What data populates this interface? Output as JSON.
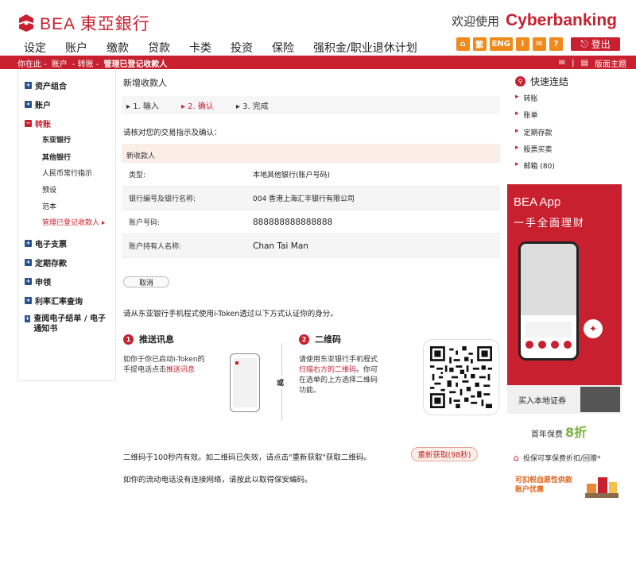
{
  "header": {
    "logo_text": "BEA 東亞銀行",
    "welcome_label": "欢迎使用",
    "welcome_brand": "Cyberbanking",
    "nav": [
      "设定",
      "账户",
      "缴款",
      "贷款",
      "卡类",
      "投资",
      "保险",
      "强积金/职业退休计划"
    ],
    "tools": [
      "⌂",
      "繁",
      "ENG",
      "i",
      "✉",
      "?"
    ],
    "logout_label": "登出"
  },
  "breadcrumb": {
    "items": [
      "你在此 -",
      "账户",
      "- 转账 -",
      "管理已登记收款人"
    ],
    "version_label": "版面主题"
  },
  "sidebar": {
    "sections": [
      {
        "label": "资产组合"
      },
      {
        "label": "账户"
      },
      {
        "label": "转账"
      },
      {
        "label": "电子支票"
      },
      {
        "label": "定期存款"
      },
      {
        "label": "申领"
      },
      {
        "label": "利率汇率查询"
      },
      {
        "label": "查阅电子结单 / 电子通知书"
      }
    ],
    "sub_items": [
      "东亚银行",
      "其他银行",
      "人民币常行指示",
      "预设",
      "范本",
      "管理已登记收款人"
    ]
  },
  "main": {
    "title": "新增收款人",
    "steps": [
      "1. 输入",
      "2. 确认",
      "3. 完成"
    ],
    "confirm_note": "请核对您的交易指示及确认：",
    "form_header": "新收款人",
    "rows": [
      {
        "label": "类型:",
        "value": "本地其他银行(账户号码)"
      },
      {
        "label": "银行编号及银行名称:",
        "value": "004 香港上海汇丰银行有限公司"
      },
      {
        "label": "账户号码:",
        "value": "888888888888888"
      },
      {
        "label": "账户持有人名称:",
        "value": "Chan Tai Man"
      }
    ],
    "cancel_label": "取消",
    "itoken_note": "请从东亚银行手机程式使用i-Token透过以下方式认证你的身分。",
    "opt1": {
      "num": "1",
      "title": "推送讯息",
      "line1": "如你于你已启动i-Token的",
      "line2a": "手提电话点击",
      "line2b": "推送讯息"
    },
    "or_label": "或",
    "opt2": {
      "num": "2",
      "title": "二维码",
      "line1": "请使用东亚银行手机程式",
      "line2a": "扫描右方的二维码",
      "line2b": "。你可",
      "line3": "在选单的上方选择二维码",
      "line4": "功能。"
    },
    "qr_note": "二维码于100秒内有效。如二维码已失效，请点击\"重新获取\"获取二维码。",
    "refresh_label": "重新获取(98秒)",
    "mobile_note": "如你的流动电话没有连接网络，请按此以取得保安编码。"
  },
  "right": {
    "quick_title": "快速连结",
    "links": [
      "转账",
      "账单",
      "定期存款",
      "股票买卖",
      "邮箱 (80)"
    ],
    "app_title": "BEA App",
    "app_sub": "一手全面理财",
    "sec_label": "买入本地证券",
    "fee_label": "首年保费",
    "fee_value": "8折",
    "tax_label": "投保可享保费折扣/回赠*",
    "promo_line1": "可扣税自愿性供款",
    "promo_line2": "账户优惠"
  }
}
